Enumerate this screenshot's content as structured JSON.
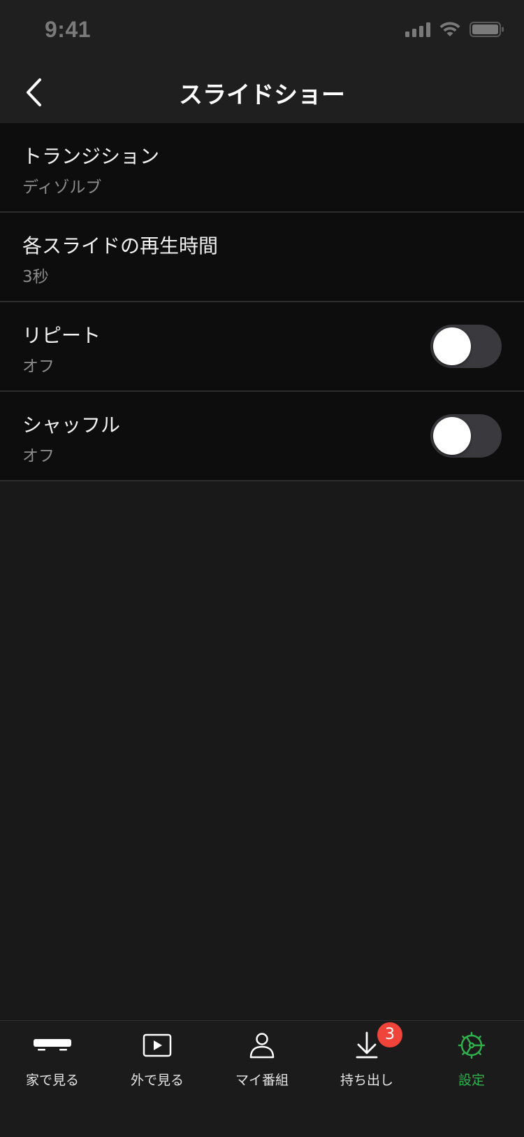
{
  "status_bar": {
    "time": "9:41",
    "battery_icon": "battery-icon",
    "wifi_icon": "wifi-icon",
    "signal_icon": "cellular-signal-icon"
  },
  "nav": {
    "title": "スライドショー",
    "back_icon": "chevron-left-icon"
  },
  "settings": [
    {
      "title": "トランジション",
      "value": "ディゾルブ",
      "has_toggle": false
    },
    {
      "title": "各スライドの再生時間",
      "value": "3秒",
      "has_toggle": false
    },
    {
      "title": "リピート",
      "value": "オフ",
      "has_toggle": true,
      "toggle_on": false
    },
    {
      "title": "シャッフル",
      "value": "オフ",
      "has_toggle": true,
      "toggle_on": false
    }
  ],
  "tabs": [
    {
      "label": "家で見る",
      "icon": "tv-box-icon",
      "active": false
    },
    {
      "label": "外で見る",
      "icon": "play-screen-icon",
      "active": false
    },
    {
      "label": "マイ番組",
      "icon": "person-icon",
      "active": false
    },
    {
      "label": "持ち出し",
      "icon": "download-icon",
      "active": false,
      "badge": "3"
    },
    {
      "label": "設定",
      "icon": "gear-icon",
      "active": true
    }
  ],
  "colors": {
    "accent": "#2fb24c",
    "badge": "#f0443a",
    "background": "#191919",
    "row_background": "#0d0d0d"
  }
}
